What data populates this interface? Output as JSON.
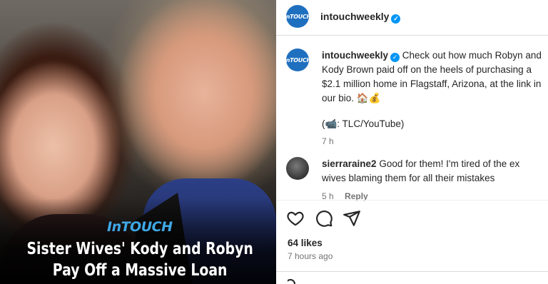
{
  "photo": {
    "brand": "InTOUCH",
    "headline_line1": "Sister Wives' Kody and Robyn",
    "headline_line2": "Pay Off a Massive Loan"
  },
  "post": {
    "header_username": "intouchweekly",
    "avatar_text": "InTOUCH",
    "caption_username": "intouchweekly",
    "caption_text": "Check out how much Robyn and Kody Brown paid off on the heels of purchasing a $2.1 million home in Flagstaff, Arizona, at the link in our bio. 🏠💰",
    "credit": "(📹: TLC/YouTube)",
    "caption_time": "7 h"
  },
  "comment": {
    "username": "sierraraine2",
    "text": "Good for them! I'm tired of the ex wives blaming them for all their mistakes",
    "time": "5 h",
    "reply_label": "Reply"
  },
  "footer": {
    "likes": "64 likes",
    "posted_ago": "7 hours ago"
  },
  "icons": {
    "like": "heart-icon",
    "comment": "comment-icon",
    "share": "share-icon",
    "verified": "verified-badge-icon"
  },
  "colors": {
    "verified_blue": "#0095f6",
    "brand_blue": "#3fa9e6",
    "avatar_blue": "#1f6fbf"
  }
}
